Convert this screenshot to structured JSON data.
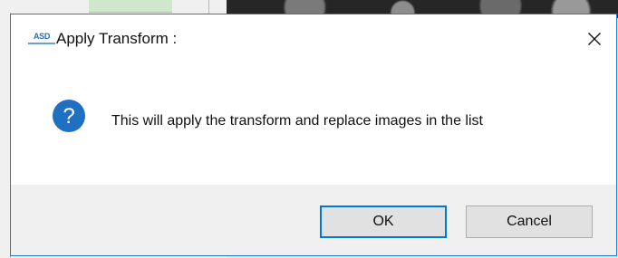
{
  "dialog": {
    "app_logo_text": "ASD",
    "title": "Apply Transform :",
    "message": "This will apply the transform and replace images in the list",
    "icon": "question-icon",
    "close_icon": "close-icon"
  },
  "buttons": {
    "ok_label": "OK",
    "cancel_label": "Cancel"
  },
  "colors": {
    "accent": "#0078d7",
    "icon_blue": "#1f6fc2",
    "footer_bg": "#f0f0f0",
    "button_bg": "#e1e1e1"
  }
}
